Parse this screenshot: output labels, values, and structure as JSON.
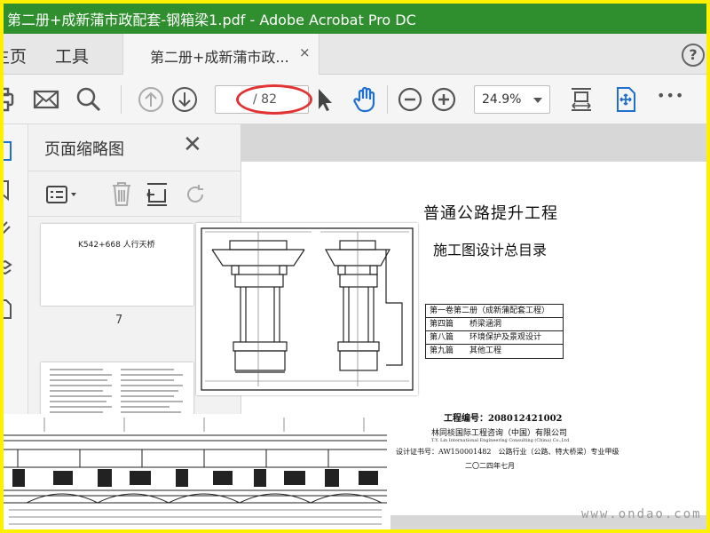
{
  "window": {
    "title": "第二册+成新蒲市政配套-钢箱梁1.pdf - Adobe Acrobat Pro DC",
    "frame_color": "#ffef00",
    "titlebar_color": "#2f8f2f"
  },
  "menu": {
    "home": "主页",
    "tools": "工具"
  },
  "tabs": [
    {
      "label": "第二册+成新蒲市政...",
      "close": "×"
    }
  ],
  "help": {
    "icon": "question-icon",
    "glyph": "?"
  },
  "toolbar": {
    "page_current": "",
    "page_total": "/ 82",
    "zoom": "24.9%",
    "icons": [
      "print-icon",
      "email-icon",
      "search-icon",
      "prev-page-icon",
      "next-page-icon",
      "select-cursor-icon",
      "hand-tool-icon",
      "zoom-out-icon",
      "zoom-in-icon",
      "fit-page-icon",
      "scroll-mode-icon",
      "more-icon"
    ],
    "annotation_color": "#e23232",
    "more_glyph": "•••"
  },
  "thumbnails_pane": {
    "title": "页面缩略图",
    "close": "✕",
    "tools": [
      "options-icon",
      "delete-icon",
      "insert-page-icon",
      "rotate-icon"
    ],
    "items": [
      {
        "label": "K542+668 人行天桥",
        "page_number": "7"
      }
    ]
  },
  "document": {
    "heading": "普通公路提升工程",
    "subheading": "施工图设计总目录",
    "toc": [
      "第一卷第二册（成新蒲配套工程）",
      "第四篇　　桥梁涵洞",
      "第八篇　　环境保护及景观设计",
      "第九篇　　其他工程"
    ],
    "project_number": "工程编号：208012421002",
    "company": "林同棪国际工程咨询（中国）有限公司",
    "company_en": "T.Y. Lin International Engineering Consulting (China) Co.,Ltd",
    "certificate": "设计证书号：AW150001482　公路行业（公路、特大桥梁）专业甲级",
    "date": "二〇二四年七月"
  },
  "watermark": "www.ondao.com"
}
